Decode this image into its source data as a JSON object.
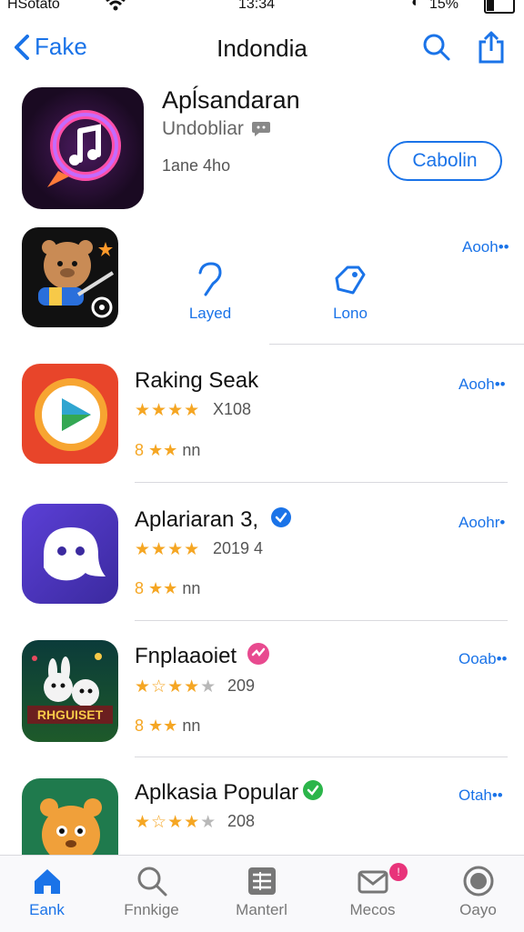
{
  "status": {
    "carrier": "HSotato",
    "time": "13:34",
    "battery": "15%"
  },
  "nav": {
    "back_label": "Fake",
    "title": "Indondia"
  },
  "featured": {
    "name": "Apĺsandaran",
    "developer": "Undobliar",
    "meta": "1ane 4ho",
    "action": "Cabolin"
  },
  "second": {
    "get": "Aooh••",
    "option1": "Layed",
    "option2": "Lono"
  },
  "apps": [
    {
      "name": "Raking Seak",
      "rating_text": "X108",
      "meta_num": "8",
      "meta_text": "nn",
      "get": "Aooh••",
      "stars": 4
    },
    {
      "name": "Aplariaran 3,",
      "rating_text": "2019 4",
      "meta_num": "8",
      "meta_text": "nn",
      "get": "Aoohr•",
      "stars": 4
    },
    {
      "name": "Fnplaaoiet",
      "rating_text": "209",
      "meta_num": "8",
      "meta_text": "nn",
      "get": "Ooab••",
      "stars": 3
    },
    {
      "name": "Aplkasia Popular",
      "rating_text": "208",
      "get": "Otah••",
      "stars": 3
    }
  ],
  "tabs": [
    {
      "label": "Eank",
      "icon": "home-icon"
    },
    {
      "label": "Fnnkige",
      "icon": "search-icon"
    },
    {
      "label": "Manterl",
      "icon": "list-icon"
    },
    {
      "label": "Mecos",
      "icon": "mail-icon"
    },
    {
      "label": "Oayo",
      "icon": "profile-icon"
    }
  ],
  "colors": {
    "accent": "#1a73e8",
    "star": "#f5a623"
  }
}
